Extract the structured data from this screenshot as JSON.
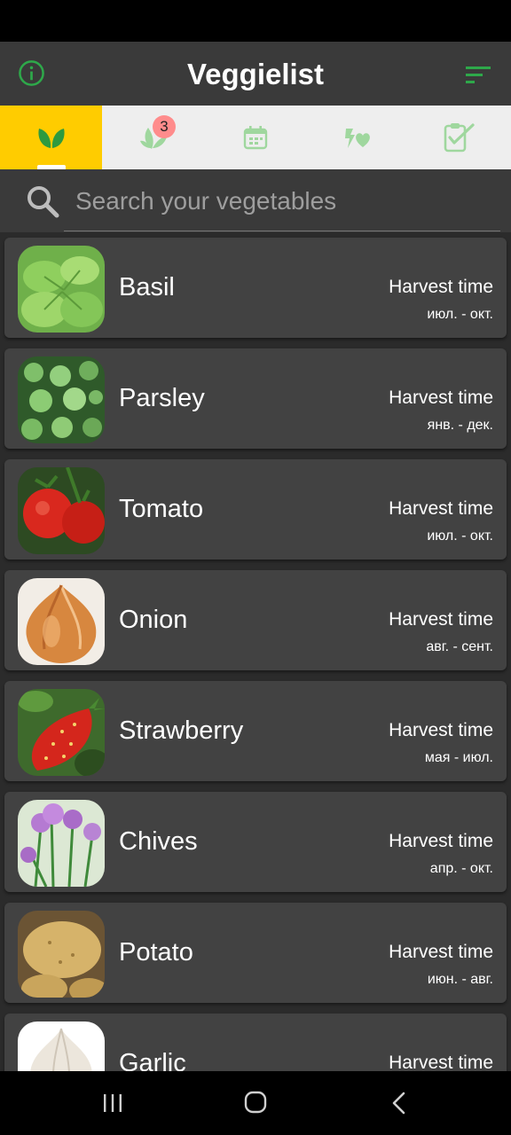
{
  "app": {
    "title": "Veggielist",
    "accent": "#2ea84a",
    "tab_active_color": "#ffcc00"
  },
  "toolbar": {
    "info_icon": "info-icon",
    "sort_icon": "sort-icon"
  },
  "tabs": [
    {
      "icon": "sprout-icon",
      "active": true
    },
    {
      "icon": "plant-leaf-icon",
      "badge": "3"
    },
    {
      "icon": "calendar-icon"
    },
    {
      "icon": "plant-heart-icon"
    },
    {
      "icon": "checklist-icon"
    }
  ],
  "search": {
    "placeholder": "Search your vegetables"
  },
  "vegetables": [
    {
      "name": "Basil",
      "harvest_label": "Harvest time",
      "harvest_period": "июл. - окт."
    },
    {
      "name": "Parsley",
      "harvest_label": "Harvest time",
      "harvest_period": "янв. - дек."
    },
    {
      "name": "Tomato",
      "harvest_label": "Harvest time",
      "harvest_period": "июл. - окт."
    },
    {
      "name": "Onion",
      "harvest_label": "Harvest time",
      "harvest_period": "авг. - сент."
    },
    {
      "name": "Strawberry",
      "harvest_label": "Harvest time",
      "harvest_period": "мая - июл."
    },
    {
      "name": "Chives",
      "harvest_label": "Harvest time",
      "harvest_period": "апр. - окт."
    },
    {
      "name": "Potato",
      "harvest_label": "Harvest time",
      "harvest_period": "июн. - авг."
    },
    {
      "name": "Garlic",
      "harvest_label": "Harvest time",
      "harvest_period": ""
    }
  ],
  "navbar": {
    "recents_icon": "recents-icon",
    "home_icon": "home-icon",
    "back_icon": "back-icon"
  }
}
